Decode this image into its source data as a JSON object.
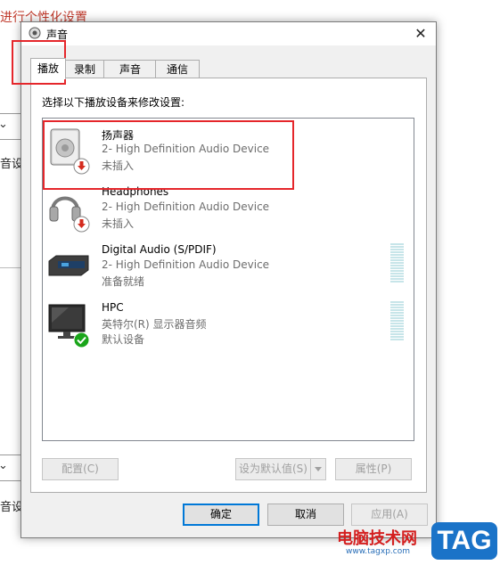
{
  "background": {
    "title": "进行个性化设置",
    "text_1": "音设",
    "text_2": "音设"
  },
  "dialog": {
    "title": "声音",
    "close_glyph": "✕",
    "tabs": [
      {
        "label": "播放"
      },
      {
        "label": "录制"
      },
      {
        "label": "声音"
      },
      {
        "label": "通信"
      }
    ],
    "instruction": "选择以下播放设备来修改设置:",
    "devices": [
      {
        "name": "扬声器",
        "subtitle": "2- High Definition Audio Device",
        "status": "未插入"
      },
      {
        "name": "Headphones",
        "subtitle": "2- High Definition Audio Device",
        "status": "未插入"
      },
      {
        "name": "Digital Audio (S/PDIF)",
        "subtitle": "2- High Definition Audio Device",
        "status": "准备就绪"
      },
      {
        "name": "HPC",
        "subtitle": "英特尔(R) 显示器音频",
        "status": "默认设备"
      }
    ],
    "buttons": {
      "configure": "配置(C)",
      "set_default": "设为默认值(S)",
      "properties": "属性(P)",
      "ok": "确定",
      "cancel": "取消",
      "apply": "应用(A)"
    }
  },
  "watermark": {
    "cn_text": "电脑技术网",
    "tag_text": "TAG",
    "url": "www.tagxp.com"
  },
  "colors": {
    "highlight_red": "#e5262b",
    "tag_blue": "#1a73c8",
    "status_disconnected": "#d42b1e",
    "status_default": "#1aa51a"
  }
}
